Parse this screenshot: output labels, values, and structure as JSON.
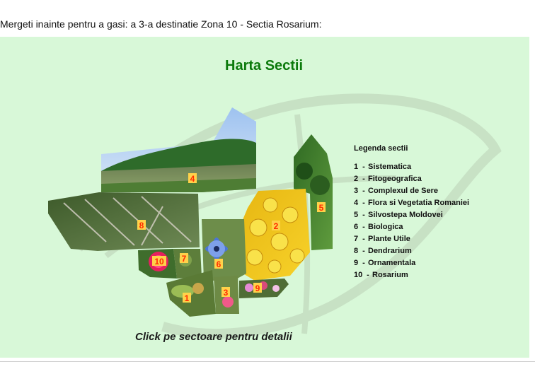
{
  "intro": {
    "text": "Mergeti inainte pentru a gasi: a 3-a destinatie Zona 10 - Sectia Rosarium:"
  },
  "map": {
    "title": "Harta Sectii",
    "click_hint": "Click pe sectoare pentru detalii",
    "background_color": "#d8f8d8",
    "title_color": "#0b7a0b",
    "marker_color": "#ffd24a",
    "marker_text_color": "#ff2a00",
    "sectors": [
      {
        "number": "1",
        "name": "Sistematica",
        "photo": "leaves-icon"
      },
      {
        "number": "2",
        "name": "Fitogeografica",
        "photo": "yellow-flowers-icon"
      },
      {
        "number": "3",
        "name": "Complexul de Sere",
        "photo": "pink-flower-icon"
      },
      {
        "number": "4",
        "name": "Flora si Vegetatia Romaniei",
        "photo": "lake-landscape-icon"
      },
      {
        "number": "5",
        "name": "Silvostepa Moldovei",
        "photo": "forest-icon"
      },
      {
        "number": "6",
        "name": "Biologica",
        "photo": "blue-flower-icon"
      },
      {
        "number": "7",
        "name": "Plante Utile",
        "photo": "plant-icon"
      },
      {
        "number": "8",
        "name": "Dendrarium",
        "photo": "tree-branch-icon"
      },
      {
        "number": "9",
        "name": "Ornamentala",
        "photo": "flower-bed-icon"
      },
      {
        "number": "10",
        "name": "Rosarium",
        "photo": "rose-icon"
      }
    ]
  },
  "legend": {
    "title": "Legenda sectii",
    "separator": "-",
    "items": [
      {
        "number": "1",
        "label": "Sistematica"
      },
      {
        "number": "2",
        "label": "Fitogeografica"
      },
      {
        "number": "3",
        "label": "Complexul de Sere"
      },
      {
        "number": "4",
        "label": "Flora si Vegetatia Romaniei"
      },
      {
        "number": "5",
        "label": "Silvostepa Moldovei"
      },
      {
        "number": "6",
        "label": "Biologica"
      },
      {
        "number": "7",
        "label": "Plante Utile"
      },
      {
        "number": "8",
        "label": "Dendrarium"
      },
      {
        "number": "9",
        "label": "Ornamentala"
      },
      {
        "number": "10",
        "label": "Rosarium"
      }
    ]
  }
}
